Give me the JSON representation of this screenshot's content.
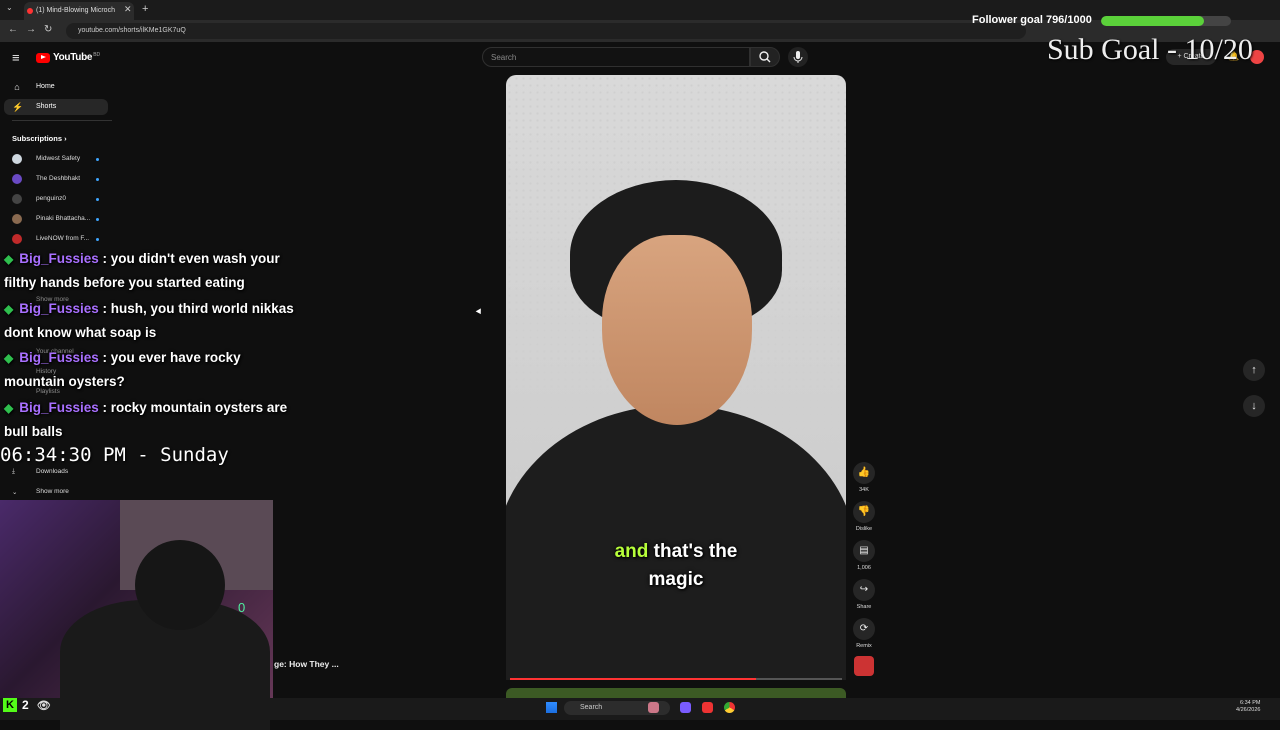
{
  "browser": {
    "tab_title": "(1) Mind-Blowing Microch",
    "url": "youtube.com/shorts/ilKMe1GK7uQ",
    "new_tab": "+",
    "close": "✕"
  },
  "youtube": {
    "logo_text": "YouTube",
    "logo_sup": "BD",
    "search_placeholder": "Search",
    "create_label": "+ Create"
  },
  "sidebar": {
    "items": [
      {
        "label": "Home",
        "icon": "home-icon"
      },
      {
        "label": "Shorts",
        "icon": "shorts-icon"
      }
    ],
    "subscriptions_label": "Subscriptions",
    "subscriptions": [
      {
        "label": "Midwest Safety",
        "color": "#cfd8e0"
      },
      {
        "label": "The Deshbhakt",
        "color": "#6a4ac4"
      },
      {
        "label": "penguinz0",
        "color": "#444444"
      },
      {
        "label": "Pinaki Bhattacha...",
        "color": "#8a6a50"
      },
      {
        "label": "LiveNOW from F...",
        "color": "#c02a2a"
      }
    ],
    "show_more_1": "Show more",
    "your_channel": "Your channel",
    "history": "History",
    "playlists": "Playlists",
    "downloads": "Downloads",
    "show_more_2": "Show more"
  },
  "video": {
    "caption_highlight": "and",
    "caption_line1": "that's the",
    "caption_line2": "magic",
    "progress_fraction": 0.74
  },
  "actions": {
    "like": "34K",
    "dislike": "Dislike",
    "comments": "1,006",
    "share": "Share",
    "remix": "Remix"
  },
  "overlay": {
    "follower_label": "Follower goal 796/1000",
    "follower_current": 796,
    "follower_target": 1000,
    "sub_goal": "Sub Goal - 10/20",
    "chat": [
      {
        "user": "Big_Fussies",
        "text": ": you didn't even wash your filthy hands before you started eating"
      },
      {
        "user": "Big_Fussies",
        "text": ": hush, you third world nikkas dont know what soap is"
      },
      {
        "user": "Big_Fussies",
        "text": ": you ever have rocky mountain oysters?"
      },
      {
        "user": "Big_Fussies",
        "text": ": rocky mountain oysters are bull balls"
      }
    ],
    "clock": "06:34:30 PM - Sunday",
    "viewer_count": "2",
    "short_title": "ge: How They ...",
    "webcam_char": "0"
  },
  "taskbar": {
    "search": "Search",
    "time": "6:34 PM",
    "date": "4/26/2026"
  }
}
